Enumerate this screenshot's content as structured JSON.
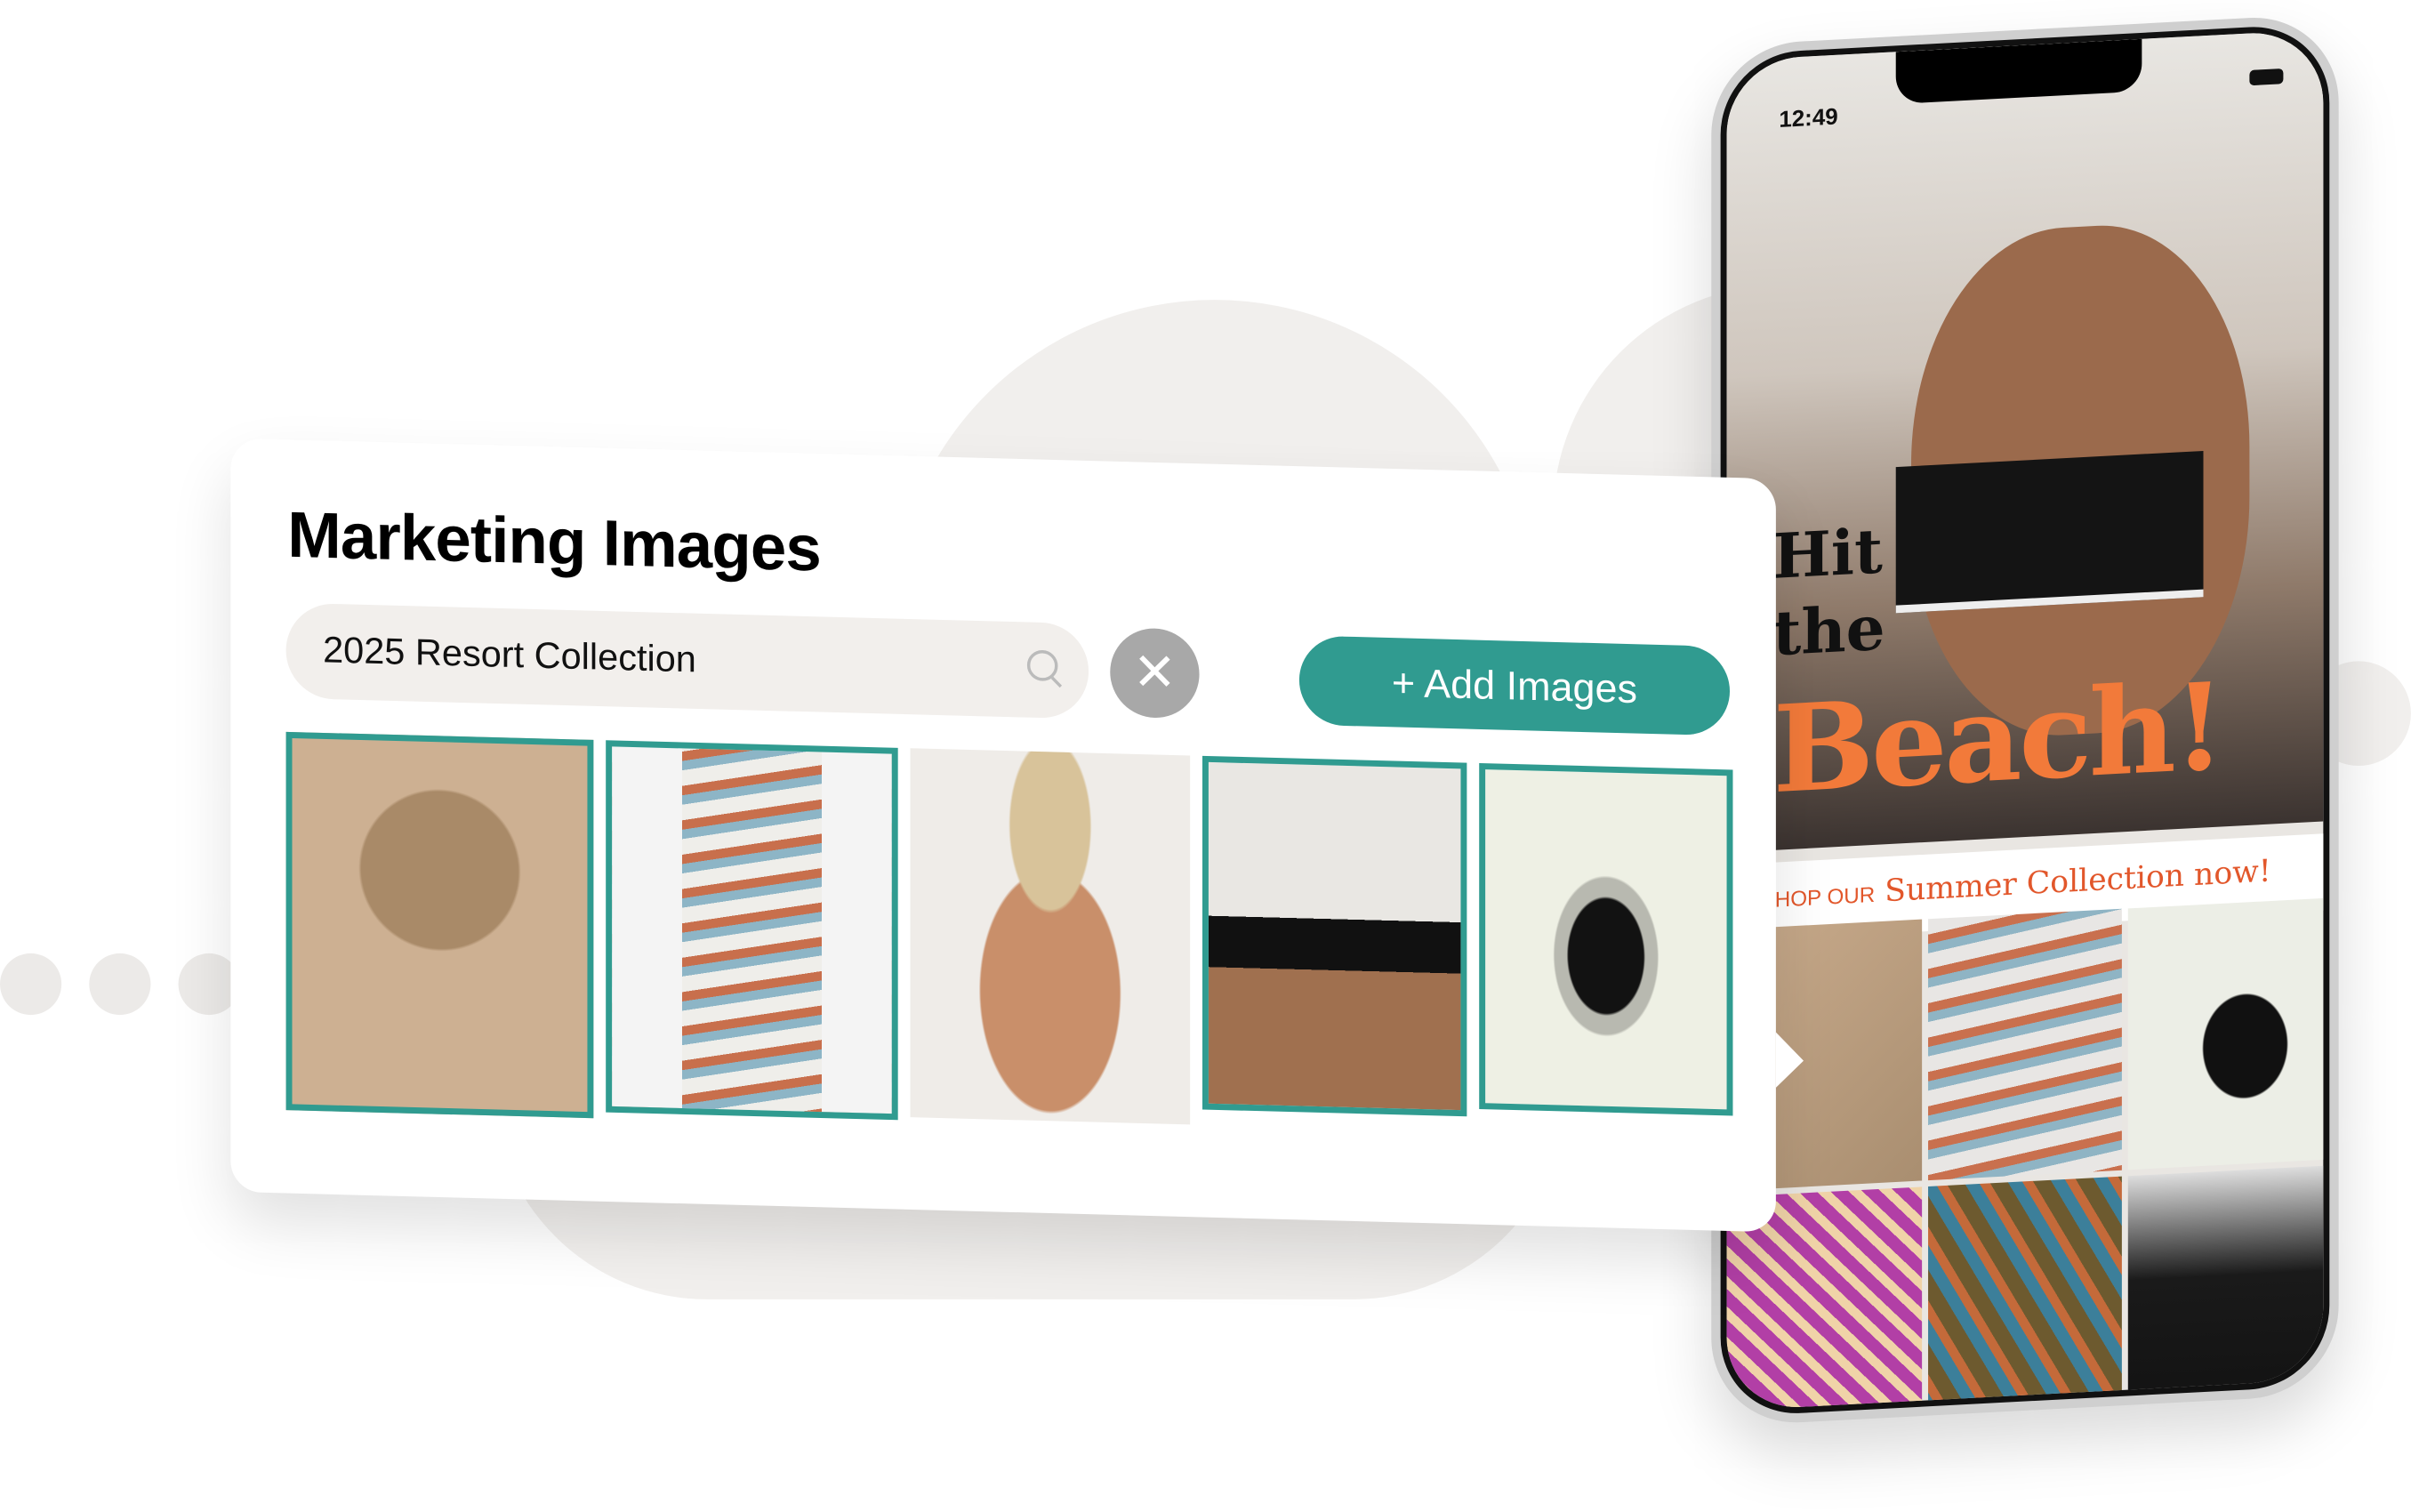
{
  "card": {
    "title": "Marketing Images",
    "search": {
      "value": "2025 Resort Collection",
      "icon": "search-icon"
    },
    "clear_icon": "close-icon",
    "clear_glyph": "✕",
    "add_button": "+ Add Images",
    "accent_color": "#309b90",
    "images": [
      {
        "subject": "hat-and-papaya",
        "selected": true
      },
      {
        "subject": "striped-knit-set",
        "selected": true
      },
      {
        "subject": "woman-bucket-hat",
        "selected": false
      },
      {
        "subject": "black-bikini-top",
        "selected": true
      },
      {
        "subject": "sunglasses",
        "selected": true
      }
    ]
  },
  "phone": {
    "status_time": "12:49",
    "headline_line1": "Hit",
    "headline_line2": "the",
    "headline_line3": "Beach!",
    "headline_color": "#f27a3a",
    "cta_prefix": "SHOP OUR",
    "cta_main": "Summer Collection now!"
  }
}
